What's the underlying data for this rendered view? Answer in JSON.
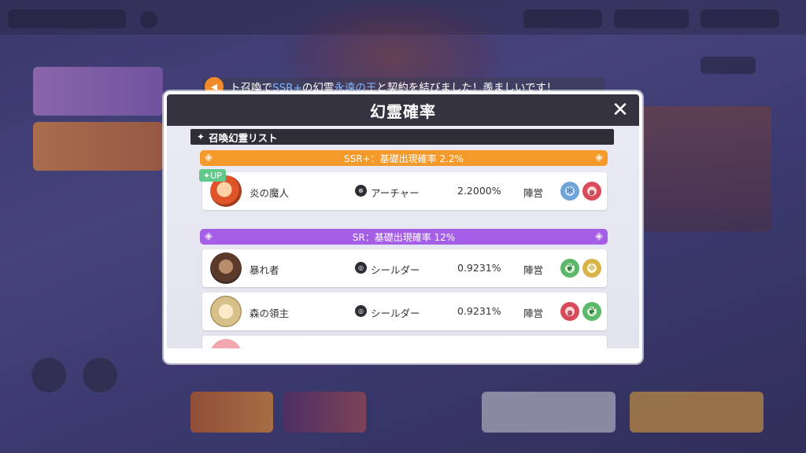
{
  "marquee": {
    "icon": "speaker-icon",
    "text_prefix": "ト召喚で",
    "text_hl1": "SSR+",
    "text_mid": "の幻霊",
    "text_hl2": "永遠の王",
    "text_suffix": "と契約を結びました！羨ましいです！"
  },
  "modal": {
    "title": "幻霊確率",
    "close_symbol": "✕",
    "section_title": "召喚幻霊リスト",
    "section_star": "✦",
    "ssr_band": "SSR+：基礎出現確率 2.2%",
    "sr_band": "SR：基礎出現確率 12%",
    "band_ornament": "◈",
    "rows": [
      {
        "badge": "✦UP",
        "name": "炎の魔人",
        "class_label": "アーチャー",
        "rate": "2.2000%",
        "camp": "陣営",
        "elements": [
          "ice-icon",
          "fire-spiral-icon"
        ]
      },
      {
        "name": "暴れ者",
        "class_label": "シールダー",
        "rate": "0.9231%",
        "camp": "陣営",
        "elements": [
          "leaf-icon",
          "holy-icon"
        ]
      },
      {
        "name": "森の領主",
        "class_label": "シールダー",
        "rate": "0.9231%",
        "camp": "陣営",
        "elements": [
          "fire-spiral-icon",
          "leaf-icon"
        ]
      }
    ]
  },
  "glyphs": {
    "ice": "❄",
    "fire": "๑",
    "leaf": "❦",
    "holy": "✧",
    "archer": "⊗",
    "shield": "◎"
  },
  "colors": {
    "ssr_band": "#f39a2b",
    "sr_band": "#a55ee6",
    "header": "#353340",
    "up_badge": "#62c98a"
  }
}
